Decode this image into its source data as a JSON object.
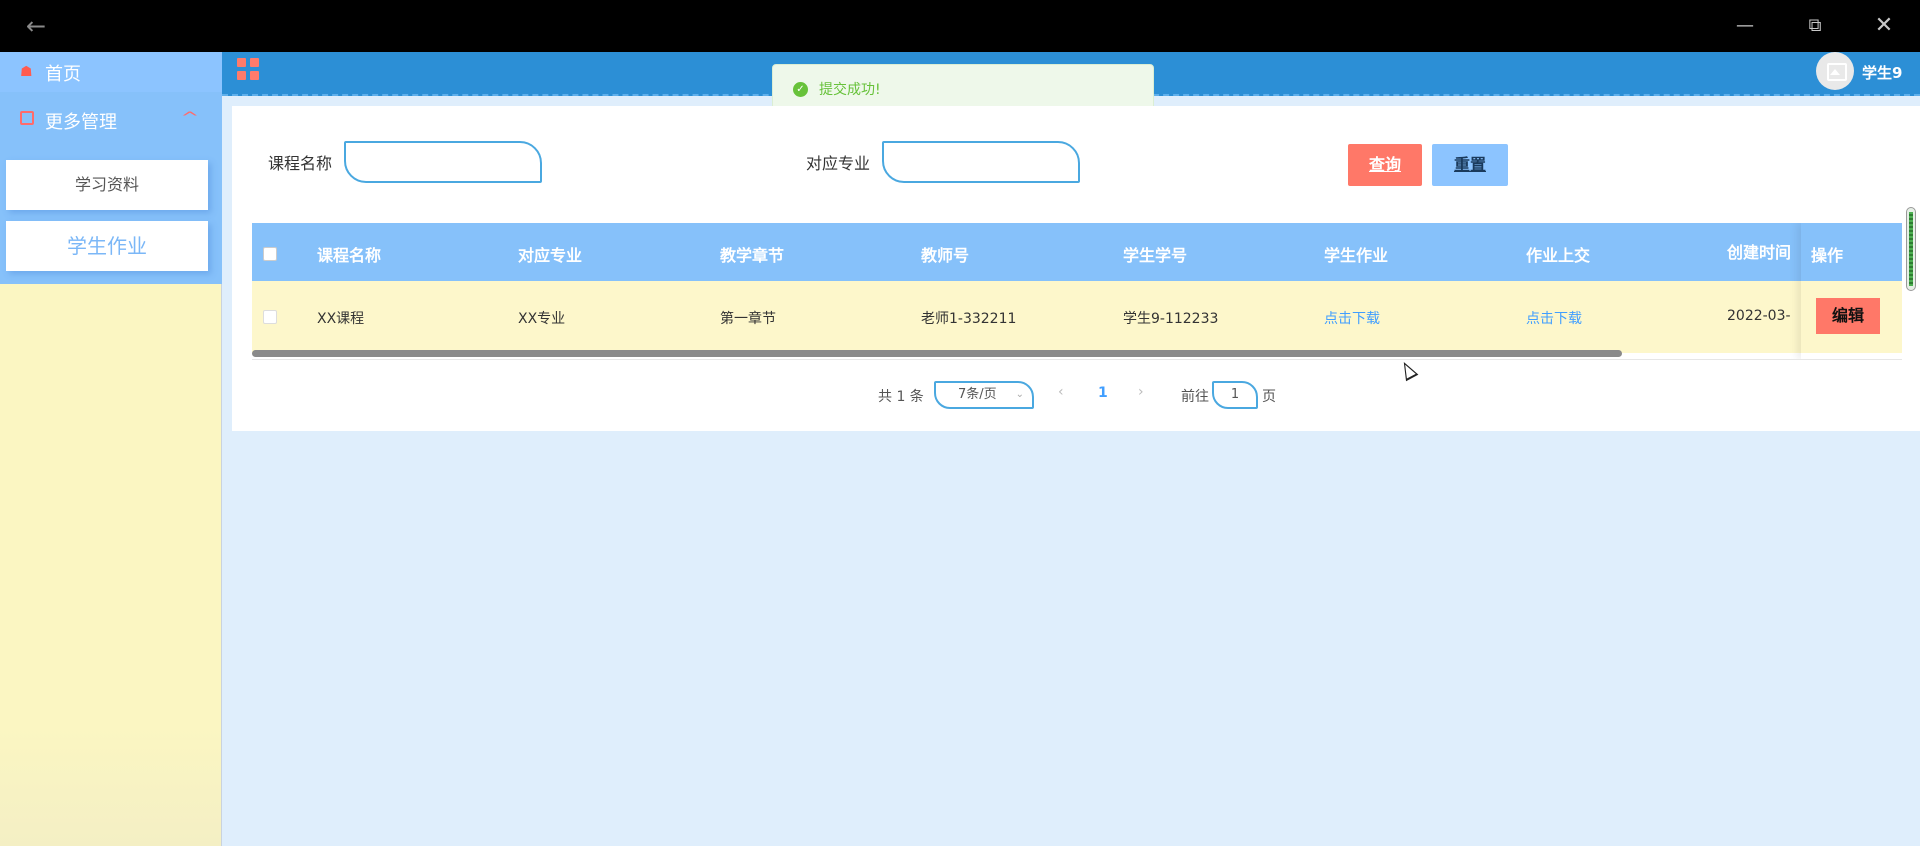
{
  "window": {
    "back_icon": "arrow-left-icon",
    "minimize_icon": "minimize-icon",
    "restore_icon": "restore-icon",
    "close_icon": "close-icon"
  },
  "sidebar": {
    "home_label": "首页",
    "home_icon": "home-icon",
    "more_label": "更多管理",
    "more_icon": "copy-icon",
    "more_expanded": true,
    "sub_items": [
      {
        "label": "学习资料"
      },
      {
        "label": "学生作业",
        "active": true
      }
    ]
  },
  "header": {
    "menu_icon": "grid-icon",
    "username": "学生9",
    "avatar_icon": "image-icon",
    "background_color": "#2c8fd6"
  },
  "toast": {
    "message": "提交成功!",
    "icon": "check-circle-icon",
    "color": "#67c23a"
  },
  "search": {
    "course_label": "课程名称",
    "course_value": "",
    "major_label": "对应专业",
    "major_value": "",
    "query_button": "查询",
    "reset_button": "重置"
  },
  "table": {
    "columns": [
      "课程名称",
      "对应专业",
      "教学章节",
      "教师号",
      "学生学号",
      "学生作业",
      "作业上交",
      "创建时间",
      "操作"
    ],
    "rows": [
      {
        "course": "XX课程",
        "major": "XX专业",
        "chapter": "第一章节",
        "teacher": "老师1-332211",
        "student": "学生9-112233",
        "homework": "点击下载",
        "submission": "点击下载",
        "created": "2022-03-",
        "action": "编辑"
      }
    ]
  },
  "pagination": {
    "total_text": "共 1 条",
    "page_size": "7条/页",
    "current_page": "1",
    "goto_label": "前往",
    "goto_value": "1",
    "page_suffix": "页"
  },
  "colors": {
    "accent_red": "#ff7868",
    "sidebar_blue": "#86c1fa",
    "row_yellow": "#fdf7cb",
    "link_blue": "#409eff"
  }
}
